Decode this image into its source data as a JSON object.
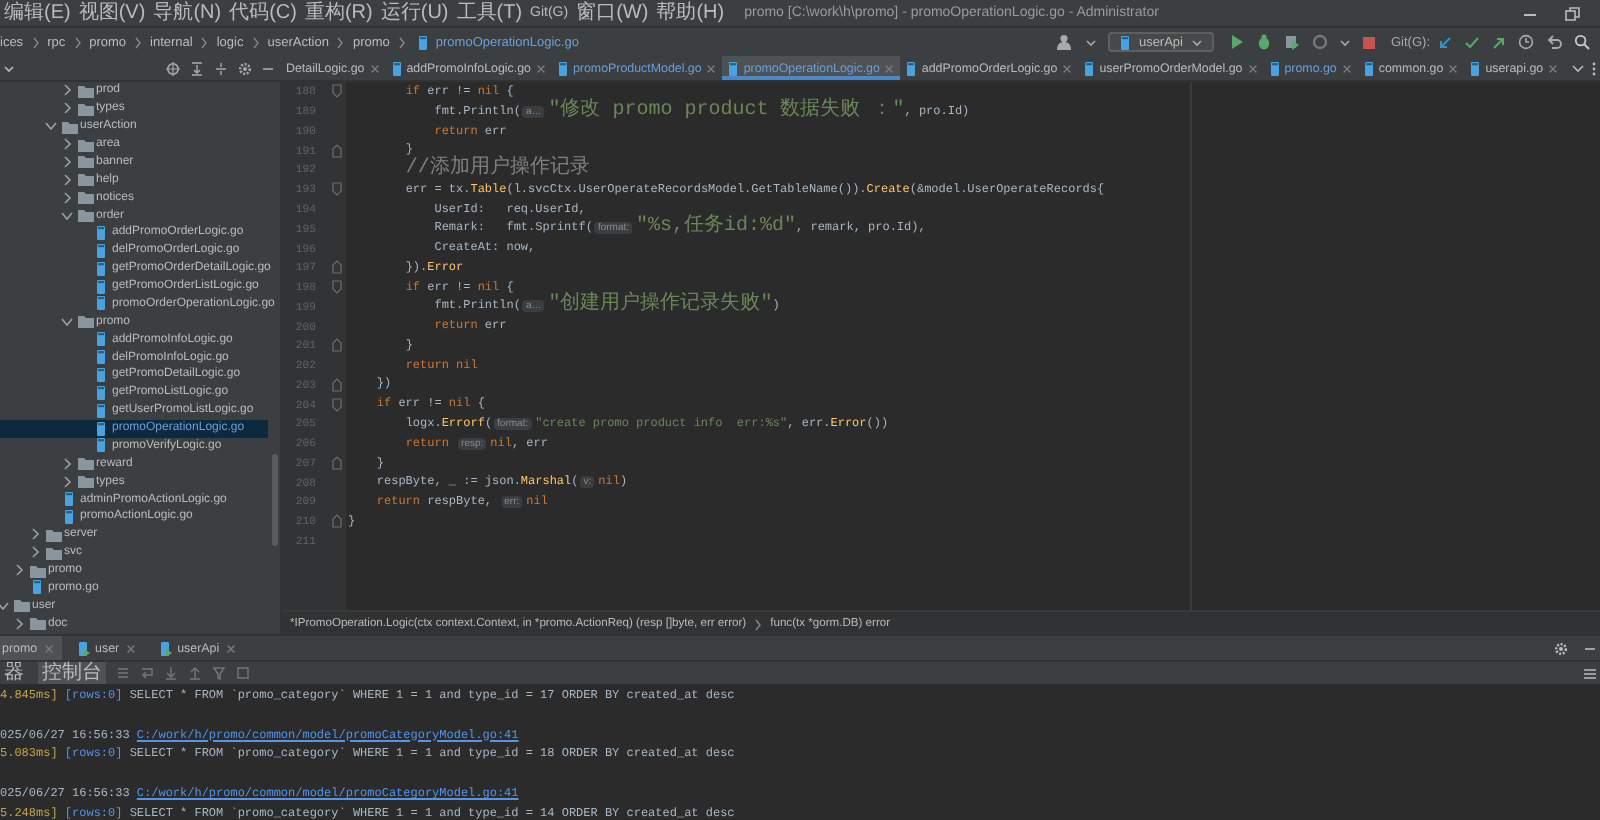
{
  "menu": [
    "编辑(E)",
    "视图(V)",
    "导航(N)",
    "代码(C)",
    "重构(R)",
    "运行(U)",
    "工具(T)",
    "Git(G)",
    "窗口(W)",
    "帮助(H)"
  ],
  "window": {
    "title": "promo [C:\\work\\h\\promo] - promoOperationLogic.go - Administrator"
  },
  "breadcrumb": [
    "ices",
    "rpc",
    "promo",
    "internal",
    "logic",
    "userAction",
    "promo",
    "promoOperationLogic.go"
  ],
  "run_config": "userApi",
  "git_label": "Git(G):",
  "tabs": [
    {
      "label": "DetailLogic.go",
      "icon": false,
      "selected": false,
      "color": "#bbbbbb"
    },
    {
      "label": "addPromoInfoLogic.go",
      "icon": true,
      "selected": false,
      "color": "#bbbbbb"
    },
    {
      "label": "promoProductModel.go",
      "icon": true,
      "selected": false,
      "color": "#6a9fd8"
    },
    {
      "label": "promoOperationLogic.go",
      "icon": true,
      "selected": true,
      "color": "#6a9fd8"
    },
    {
      "label": "addPromoOrderLogic.go",
      "icon": true,
      "selected": false,
      "color": "#bbbbbb"
    },
    {
      "label": "userPromoOrderModel.go",
      "icon": true,
      "selected": false,
      "color": "#bbbbbb"
    },
    {
      "label": "promo.go",
      "icon": true,
      "selected": false,
      "color": "#6a9fd8"
    },
    {
      "label": "common.go",
      "icon": true,
      "selected": false,
      "color": "#bbbbbb"
    },
    {
      "label": "userapi.go",
      "icon": true,
      "selected": false,
      "color": "#bbbbbb"
    }
  ],
  "tree": [
    {
      "label": "prod",
      "kind": "folder",
      "expanded": false,
      "selected": false
    },
    {
      "label": "types",
      "kind": "folder",
      "expanded": false,
      "selected": false
    },
    {
      "label": "userAction",
      "kind": "folder",
      "expanded": true,
      "selected": false,
      "children": [
        {
          "label": "area",
          "kind": "folder",
          "expanded": false,
          "selected": false
        },
        {
          "label": "banner",
          "kind": "folder",
          "expanded": false,
          "selected": false
        },
        {
          "label": "help",
          "kind": "folder",
          "expanded": false,
          "selected": false
        },
        {
          "label": "notices",
          "kind": "folder",
          "expanded": false,
          "selected": false
        },
        {
          "label": "order",
          "kind": "folder",
          "expanded": true,
          "selected": false,
          "children": [
            {
              "label": "addPromoOrderLogic.go",
              "kind": "file",
              "selected": false
            },
            {
              "label": "delPromoOrderLogic.go",
              "kind": "file",
              "selected": false
            },
            {
              "label": "getPromoOrderDetailLogic.go",
              "kind": "file",
              "selected": false
            },
            {
              "label": "getPromoOrderListLogic.go",
              "kind": "file",
              "selected": false
            },
            {
              "label": "promoOrderOperationLogic.go",
              "kind": "file",
              "selected": false
            }
          ]
        },
        {
          "label": "promo",
          "kind": "folder",
          "expanded": true,
          "selected": false,
          "children": [
            {
              "label": "addPromoInfoLogic.go",
              "kind": "file",
              "selected": false
            },
            {
              "label": "delPromoInfoLogic.go",
              "kind": "file",
              "selected": false
            },
            {
              "label": "getPromoDetailLogic.go",
              "kind": "file",
              "selected": false
            },
            {
              "label": "getPromoListLogic.go",
              "kind": "file",
              "selected": false
            },
            {
              "label": "getUserPromoListLogic.go",
              "kind": "file",
              "selected": false
            },
            {
              "label": "promoOperationLogic.go",
              "kind": "file",
              "selected": true
            },
            {
              "label": "promoVerifyLogic.go",
              "kind": "file",
              "selected": false
            }
          ]
        },
        {
          "label": "reward",
          "kind": "folder",
          "expanded": false,
          "selected": false
        },
        {
          "label": "types",
          "kind": "folder",
          "expanded": false,
          "selected": false
        }
      ]
    },
    {
      "label": "adminPromoActionLogic.go",
      "kind": "file",
      "selected": false
    },
    {
      "label": "promoActionLogic.go",
      "kind": "file",
      "selected": false
    },
    {
      "label": "server",
      "kind": "folder",
      "expanded": false,
      "selected": false
    },
    {
      "label": "svc",
      "kind": "folder",
      "expanded": false,
      "selected": false
    },
    {
      "label": "promo",
      "kind": "folder",
      "expanded": false,
      "selected": false
    },
    {
      "label": "promo.go",
      "kind": "file",
      "selected": false
    },
    {
      "label": "user",
      "kind": "folder",
      "expanded": true,
      "selected": false,
      "children": [
        {
          "label": "doc",
          "kind": "folder",
          "expanded": false,
          "selected": false
        }
      ]
    }
  ],
  "editor": {
    "lines": [
      {
        "number": "188",
        "fold_start": true,
        "fold_end": false,
        "tokens": [
          {
            "kind": "kw",
            "text": "\t\tif"
          },
          {
            "kind": "plain",
            "text": " err != "
          },
          {
            "kind": "kw",
            "text": "nil"
          },
          {
            "kind": "plain",
            "text": " {"
          }
        ]
      },
      {
        "number": "189",
        "fold_start": false,
        "fold_end": false,
        "tokens": [
          {
            "kind": "plain",
            "text": "\t\t\tfmt.Println("
          },
          {
            "kind": "hint",
            "text": "a…"
          },
          {
            "kind": "str",
            "text": "\"修改 promo product 数据失败 ：\""
          },
          {
            "kind": "plain",
            "text": ", pro.Id)"
          }
        ]
      },
      {
        "number": "190",
        "fold_start": false,
        "fold_end": false,
        "tokens": [
          {
            "kind": "kw",
            "text": "\t\t\treturn"
          },
          {
            "kind": "plain",
            "text": " err"
          }
        ]
      },
      {
        "number": "191",
        "fold_start": false,
        "fold_end": true,
        "tokens": [
          {
            "kind": "plain",
            "text": "\t\t}"
          }
        ]
      },
      {
        "number": "192",
        "fold_start": false,
        "fold_end": false,
        "tokens": [
          {
            "kind": "comment",
            "text": "\t\t//添加用户操作记录"
          }
        ]
      },
      {
        "number": "193",
        "fold_start": true,
        "fold_end": false,
        "tokens": [
          {
            "kind": "plain",
            "text": "\t\terr = tx."
          },
          {
            "kind": "fn",
            "text": "Table"
          },
          {
            "kind": "plain",
            "text": "(l.svcCtx.UserOperateRecordsModel.GetTableName())."
          },
          {
            "kind": "fn",
            "text": "Create"
          },
          {
            "kind": "plain",
            "text": "(&model.UserOperateRecords{"
          }
        ]
      },
      {
        "number": "194",
        "fold_start": false,
        "fold_end": false,
        "tokens": [
          {
            "kind": "plain",
            "text": "\t\t\tUserId:   req.UserId,"
          }
        ]
      },
      {
        "number": "195",
        "fold_start": false,
        "fold_end": false,
        "tokens": [
          {
            "kind": "plain",
            "text": "\t\t\tRemark:   fmt.Sprintf("
          },
          {
            "kind": "hint",
            "text": "format:"
          },
          {
            "kind": "str",
            "text": "\"%s,任务id:%d\""
          },
          {
            "kind": "plain",
            "text": ", remark, pro.Id),"
          }
        ]
      },
      {
        "number": "196",
        "fold_start": false,
        "fold_end": false,
        "tokens": [
          {
            "kind": "plain",
            "text": "\t\t\tCreateAt: now,"
          }
        ]
      },
      {
        "number": "197",
        "fold_start": false,
        "fold_end": true,
        "tokens": [
          {
            "kind": "plain",
            "text": "\t\t})."
          },
          {
            "kind": "fn",
            "text": "Error"
          }
        ]
      },
      {
        "number": "198",
        "fold_start": true,
        "fold_end": false,
        "tokens": [
          {
            "kind": "kw",
            "text": "\t\tif"
          },
          {
            "kind": "plain",
            "text": " err != "
          },
          {
            "kind": "kw",
            "text": "nil"
          },
          {
            "kind": "plain",
            "text": " {"
          }
        ]
      },
      {
        "number": "199",
        "fold_start": false,
        "fold_end": false,
        "tokens": [
          {
            "kind": "plain",
            "text": "\t\t\tfmt.Println("
          },
          {
            "kind": "hint",
            "text": "a…"
          },
          {
            "kind": "str",
            "text": "\"创建用户操作记录失败\""
          },
          {
            "kind": "plain",
            "text": ")"
          }
        ]
      },
      {
        "number": "200",
        "fold_start": false,
        "fold_end": false,
        "tokens": [
          {
            "kind": "kw",
            "text": "\t\t\treturn"
          },
          {
            "kind": "plain",
            "text": " err"
          }
        ]
      },
      {
        "number": "201",
        "fold_start": false,
        "fold_end": true,
        "tokens": [
          {
            "kind": "plain",
            "text": "\t\t}"
          }
        ]
      },
      {
        "number": "202",
        "fold_start": false,
        "fold_end": false,
        "tokens": [
          {
            "kind": "kw",
            "text": "\t\treturn nil"
          }
        ]
      },
      {
        "number": "203",
        "fold_start": false,
        "fold_end": true,
        "tokens": [
          {
            "kind": "plain",
            "text": "\t})"
          }
        ]
      },
      {
        "number": "204",
        "fold_start": true,
        "fold_end": false,
        "tokens": [
          {
            "kind": "kw",
            "text": "\tif"
          },
          {
            "kind": "plain",
            "text": " err != "
          },
          {
            "kind": "kw",
            "text": "nil"
          },
          {
            "kind": "plain",
            "text": " {"
          }
        ]
      },
      {
        "number": "205",
        "fold_start": false,
        "fold_end": false,
        "tokens": [
          {
            "kind": "plain",
            "text": "\t\tlogx."
          },
          {
            "kind": "fn",
            "text": "Errorf"
          },
          {
            "kind": "plain",
            "text": "("
          },
          {
            "kind": "hint",
            "text": "format:"
          },
          {
            "kind": "str",
            "text": "\"create promo product info  err:%s\""
          },
          {
            "kind": "plain",
            "text": ", err."
          },
          {
            "kind": "fn",
            "text": "Error"
          },
          {
            "kind": "plain",
            "text": "())"
          }
        ]
      },
      {
        "number": "206",
        "fold_start": false,
        "fold_end": false,
        "tokens": [
          {
            "kind": "kw",
            "text": "\t\treturn "
          },
          {
            "kind": "hint",
            "text": "resp:"
          },
          {
            "kind": "kw",
            "text": "nil"
          },
          {
            "kind": "plain",
            "text": ", err"
          }
        ]
      },
      {
        "number": "207",
        "fold_start": false,
        "fold_end": true,
        "tokens": [
          {
            "kind": "plain",
            "text": "\t}"
          }
        ]
      },
      {
        "number": "208",
        "fold_start": false,
        "fold_end": false,
        "tokens": [
          {
            "kind": "plain",
            "text": "\trespByte, _ := json."
          },
          {
            "kind": "fn",
            "text": "Marshal"
          },
          {
            "kind": "plain",
            "text": "("
          },
          {
            "kind": "hint",
            "text": "v:"
          },
          {
            "kind": "kw",
            "text": "nil"
          },
          {
            "kind": "plain",
            "text": ")"
          }
        ]
      },
      {
        "number": "209",
        "fold_start": false,
        "fold_end": false,
        "tokens": [
          {
            "kind": "kw",
            "text": "\treturn"
          },
          {
            "kind": "plain",
            "text": " respByte, "
          },
          {
            "kind": "hint",
            "text": "err:"
          },
          {
            "kind": "kw",
            "text": "nil"
          }
        ]
      },
      {
        "number": "210",
        "fold_start": false,
        "fold_end": true,
        "tokens": [
          {
            "kind": "plain",
            "text": "}"
          }
        ]
      },
      {
        "number": "211",
        "fold_start": false,
        "fold_end": false
      }
    ]
  },
  "code_breadcrumb": [
    "*IPromoOperation.Logic(ctx context.Context, in *promo.ActionReq) (resp []byte, err error)",
    "func(tx *gorm.DB) error"
  ],
  "run_tabs": [
    {
      "label": "promo",
      "icon": false,
      "selected": true
    },
    {
      "label": "user",
      "icon": true,
      "selected": false
    },
    {
      "label": "userApi",
      "icon": true,
      "selected": false
    }
  ],
  "console_tabs": [
    {
      "label": "器",
      "selected": false
    },
    {
      "label": "控制台",
      "selected": true
    }
  ],
  "console": [
    {
      "kind": "output",
      "parts": [
        {
          "kind": "duration",
          "text": "4.845ms]"
        },
        {
          "kind": "rows",
          "text": " [rows:0]"
        },
        {
          "kind": "text",
          "text": " SELECT * FROM `promo_category` WHERE 1 = 1 and type_id = 17 ORDER BY created_at desc"
        }
      ]
    },
    {
      "kind": "blank"
    },
    {
      "kind": "output",
      "parts": [
        {
          "kind": "text",
          "text": "025/06/27 16:56:33 "
        },
        {
          "kind": "link",
          "text": "C:/work/h/promo/common/model/promoCategoryModel.go:41"
        }
      ]
    },
    {
      "kind": "output",
      "parts": [
        {
          "kind": "duration",
          "text": "5.083ms]"
        },
        {
          "kind": "rows",
          "text": " [rows:0]"
        },
        {
          "kind": "text",
          "text": " SELECT * FROM `promo_category` WHERE 1 = 1 and type_id = 18 ORDER BY created_at desc"
        }
      ]
    },
    {
      "kind": "blank"
    },
    {
      "kind": "output",
      "parts": [
        {
          "kind": "text",
          "text": "025/06/27 16:56:33 "
        },
        {
          "kind": "link",
          "text": "C:/work/h/promo/common/model/promoCategoryModel.go:41"
        }
      ]
    },
    {
      "kind": "output",
      "parts": [
        {
          "kind": "duration",
          "text": "5.248ms]"
        },
        {
          "kind": "rows",
          "text": " [rows:0]"
        },
        {
          "kind": "text",
          "text": " SELECT * FROM `promo_category` WHERE 1 = 1 and type_id = 14 ORDER BY created_at desc"
        }
      ]
    }
  ]
}
